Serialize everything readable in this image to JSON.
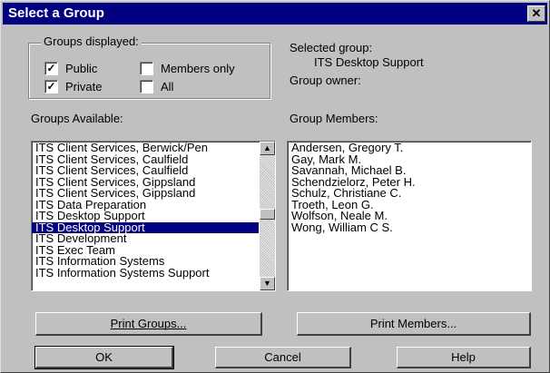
{
  "window": {
    "title": "Select a Group",
    "close_glyph": "✕"
  },
  "groups_displayed": {
    "legend": "Groups displayed:",
    "options": [
      {
        "label": "Public",
        "checked": true
      },
      {
        "label": "Members only",
        "checked": false
      },
      {
        "label": "Private",
        "checked": true
      },
      {
        "label": "All",
        "checked": false
      }
    ]
  },
  "selected_group": {
    "label": "Selected group:",
    "value": "ITS Desktop Support"
  },
  "group_owner": {
    "label": "Group owner:"
  },
  "groups_available": {
    "label": "Groups Available:",
    "items": [
      "ITS Client Services, Berwick/Pen",
      "ITS Client Services, Caulfield",
      "ITS Client Services, Caulfield",
      "ITS Client Services, Gippsland",
      "ITS Client Services, Gippsland",
      "ITS Data Preparation",
      "ITS Desktop Support",
      "ITS Desktop Support",
      "ITS Development",
      "ITS Exec Team",
      "ITS Information Systems",
      "ITS Information Systems Support"
    ],
    "selected_index": 7
  },
  "group_members": {
    "label": "Group Members:",
    "items": [
      "Andersen, Gregory T.",
      "Gay, Mark M.",
      "Savannah, Michael B.",
      "Schendzielorz, Peter H.",
      "Schulz, Christiane C.",
      "Troeth, Leon G.",
      "Wolfson, Neale M.",
      "Wong, William C S."
    ]
  },
  "buttons": {
    "print_groups": "Print Groups...",
    "print_members": "Print Members...",
    "ok": "OK",
    "cancel": "Cancel",
    "help": "Help"
  },
  "scrollbar": {
    "up_glyph": "▲",
    "down_glyph": "▼"
  }
}
